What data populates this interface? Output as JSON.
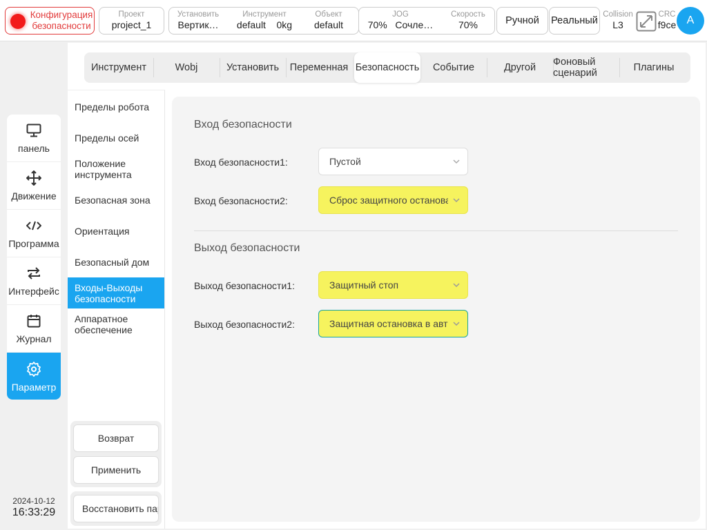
{
  "topbar": {
    "safety_config": "Конфигурация безопасности",
    "project": {
      "label": "Проект",
      "value": "project_1"
    },
    "install": {
      "label": "Установить",
      "value": "Вертик…"
    },
    "tool": {
      "label": "Инструмент",
      "value": "default",
      "load": "0kg"
    },
    "object": {
      "label": "Объект",
      "value": "default"
    },
    "jog": {
      "label": "JOG",
      "percent": "70%",
      "mode": "Сочле…"
    },
    "speed": {
      "label": "Скорость",
      "value": "70%"
    },
    "manual": "Ручной",
    "real": "Реальный",
    "collision": {
      "label": "Collision",
      "value": "L3"
    },
    "crc": {
      "label": "CRC",
      "value": "f9ce"
    },
    "avatar": "A"
  },
  "nav": {
    "items": [
      {
        "label": "панель",
        "icon": "monitor-icon"
      },
      {
        "label": "Движение",
        "icon": "move-icon"
      },
      {
        "label": "Программа",
        "icon": "code-icon"
      },
      {
        "label": "Интерфейс",
        "icon": "swap-icon"
      },
      {
        "label": "Журнал",
        "icon": "calendar-icon"
      },
      {
        "label": "Параметр",
        "icon": "gear-icon"
      }
    ],
    "active_index": 5
  },
  "datetime": {
    "date": "2024-10-12",
    "time": "16:33:29"
  },
  "tabs": [
    "Инструмент",
    "Wobj",
    "Установить",
    "Переменная",
    "Безопасность",
    "Событие",
    "Другой",
    "Фоновый сценарий",
    "Плагины"
  ],
  "active_tab": "Безопасность",
  "subnav": {
    "items": [
      "Пределы робота",
      "Пределы осей",
      "Положение инструмента",
      "Безопасная зона",
      "Ориентация",
      "Безопасный дом",
      "Входы-Выходы безопасности",
      "Аппаратное обеспечение"
    ],
    "active": "Входы-Выходы безопасности",
    "back": "Возврат",
    "apply": "Применить",
    "restore": "Восстановить параметры"
  },
  "content": {
    "input_title": "Вход безопасности",
    "inputs": [
      {
        "label": "Вход безопасности1:",
        "value": "Пустой"
      },
      {
        "label": "Вход безопасности2:",
        "value": "Сброс защитного останова"
      }
    ],
    "output_title": "Выход безопасности",
    "outputs": [
      {
        "label": "Выход безопасности1:",
        "value": "Защитный стоп"
      },
      {
        "label": "Выход безопасности2:",
        "value": "Защитная остановка в авт"
      }
    ]
  },
  "colors": {
    "accent": "#1aa5f0",
    "alarm": "#f21b1b",
    "highlight": "#f6f35e"
  }
}
